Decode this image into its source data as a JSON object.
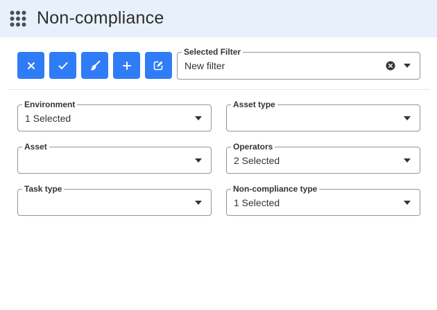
{
  "header": {
    "title": "Non-compliance",
    "apps_icon": "apps-grid-icon"
  },
  "toolbar": {
    "buttons": [
      {
        "name": "clear-button",
        "icon": "close-icon"
      },
      {
        "name": "apply-button",
        "icon": "check-icon"
      },
      {
        "name": "reset-button",
        "icon": "broom-icon"
      },
      {
        "name": "add-button",
        "icon": "plus-icon"
      },
      {
        "name": "edit-button",
        "icon": "edit-icon"
      }
    ],
    "button_color": "#2f7cf6"
  },
  "selected_filter": {
    "label": "Selected Filter",
    "value": "New filter"
  },
  "filters": {
    "environment": {
      "label": "Environment",
      "value": "1 Selected"
    },
    "asset_type": {
      "label": "Asset type",
      "value": ""
    },
    "asset": {
      "label": "Asset",
      "value": ""
    },
    "operators": {
      "label": "Operators",
      "value": "2 Selected"
    },
    "task_type": {
      "label": "Task type",
      "value": ""
    },
    "non_compliance_type": {
      "label": "Non-compliance type",
      "value": "1 Selected"
    }
  }
}
